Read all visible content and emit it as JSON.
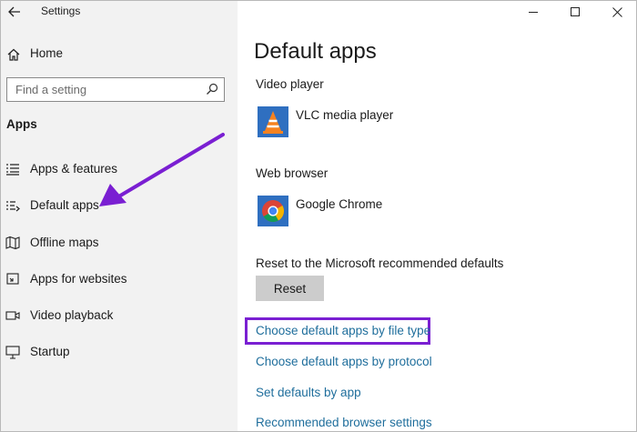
{
  "window": {
    "title": "Settings"
  },
  "sidebar": {
    "home_label": "Home",
    "search_placeholder": "Find a setting",
    "section_label": "Apps",
    "items": [
      {
        "label": "Apps & features",
        "icon": "list-icon"
      },
      {
        "label": "Default apps",
        "icon": "default-apps-icon"
      },
      {
        "label": "Offline maps",
        "icon": "map-icon"
      },
      {
        "label": "Apps for websites",
        "icon": "website-icon"
      },
      {
        "label": "Video playback",
        "icon": "video-icon"
      },
      {
        "label": "Startup",
        "icon": "startup-icon"
      }
    ]
  },
  "main": {
    "title": "Default apps",
    "video_player": {
      "label": "Video player",
      "app": "VLC media player"
    },
    "web_browser": {
      "label": "Web browser",
      "app": "Google Chrome"
    },
    "reset": {
      "label": "Reset to the Microsoft recommended defaults",
      "button": "Reset"
    },
    "links": [
      "Choose default apps by file type",
      "Choose default apps by protocol",
      "Set defaults by app",
      "Recommended browser settings"
    ]
  },
  "colors": {
    "link": "#1f6e9c",
    "annotation": "#7a1fd2",
    "sidebar_bg": "#f2f2f2",
    "button_bg": "#cccccc"
  }
}
